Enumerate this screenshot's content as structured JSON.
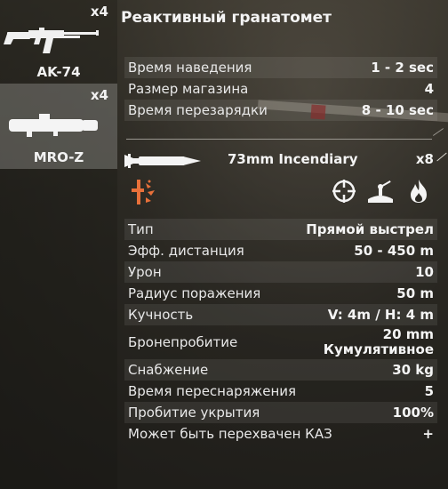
{
  "weapons": [
    {
      "name": "AK-74",
      "count": "x4",
      "selected": false
    },
    {
      "name": "MRO-Z",
      "count": "x4",
      "selected": true
    }
  ],
  "panel": {
    "title": "Реактивный гранатомет",
    "weapon_stats": [
      {
        "label": "Время наведения",
        "value": "1 - 2 sec"
      },
      {
        "label": "Размер магазина",
        "value": "4"
      },
      {
        "label": "Время перезарядки",
        "value": "8 - 10 sec"
      }
    ],
    "ammo": {
      "name": "73mm Incendiary",
      "count": "x8"
    },
    "ammo_icons": [
      "explosion-icon",
      "crosshair-icon",
      "soldier-prone-icon",
      "fire-icon"
    ],
    "ammo_stats": [
      {
        "label": "Тип",
        "value": "Прямой выстрел"
      },
      {
        "label": "Эфф. дистанция",
        "value": "50 - 450 m"
      },
      {
        "label": "Урон",
        "value": "10"
      },
      {
        "label": "Радиус поражения",
        "value": "50 m"
      },
      {
        "label": "Кучность",
        "value": "V: 4m / H: 4 m"
      },
      {
        "label": "Бронепробитие",
        "value_line1": "20 mm",
        "value_line2": "Кумулятивное"
      },
      {
        "label": "Снабжение",
        "value": "30 kg"
      },
      {
        "label": "Время переснаряжения",
        "value": "5"
      },
      {
        "label": "Пробитие укрытия",
        "value": "100%"
      },
      {
        "label": "Может быть перехвачен КАЗ",
        "value": "+"
      }
    ]
  },
  "colors": {
    "accent_orange": "#e8703a",
    "text": "#ececec"
  }
}
